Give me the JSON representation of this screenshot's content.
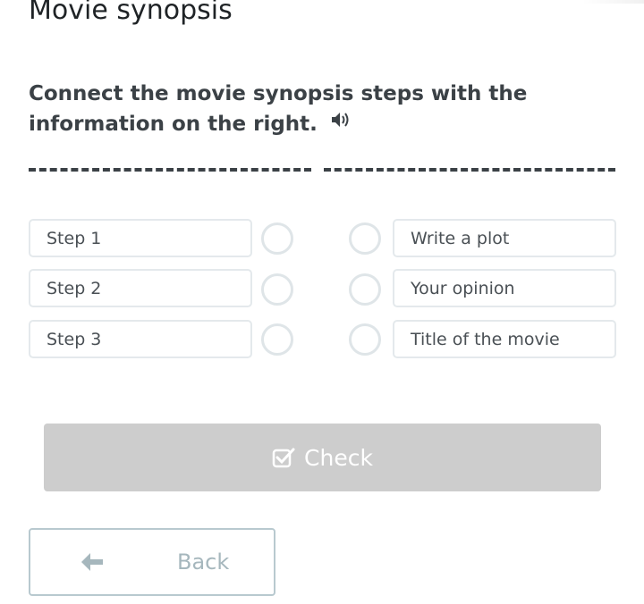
{
  "page": {
    "title": "Movie synopsis",
    "instruction": "Connect the movie synopsis steps with the information on the right."
  },
  "left_items": [
    {
      "label": "Step 1"
    },
    {
      "label": "Step 2"
    },
    {
      "label": "Step 3"
    }
  ],
  "right_items": [
    {
      "label": "Write a plot"
    },
    {
      "label": "Your opinion"
    },
    {
      "label": "Title of the movie"
    }
  ],
  "buttons": {
    "check_label": "Check",
    "back_label": "Back"
  },
  "icons": {
    "speaker": "speaker-icon",
    "check": "checkbox-check-icon",
    "back": "arrow-left-icon"
  },
  "colors": {
    "check_button_bg": "#cdcdcd",
    "back_button_border": "#b8c9cf",
    "item_border": "#e4e9ec"
  }
}
